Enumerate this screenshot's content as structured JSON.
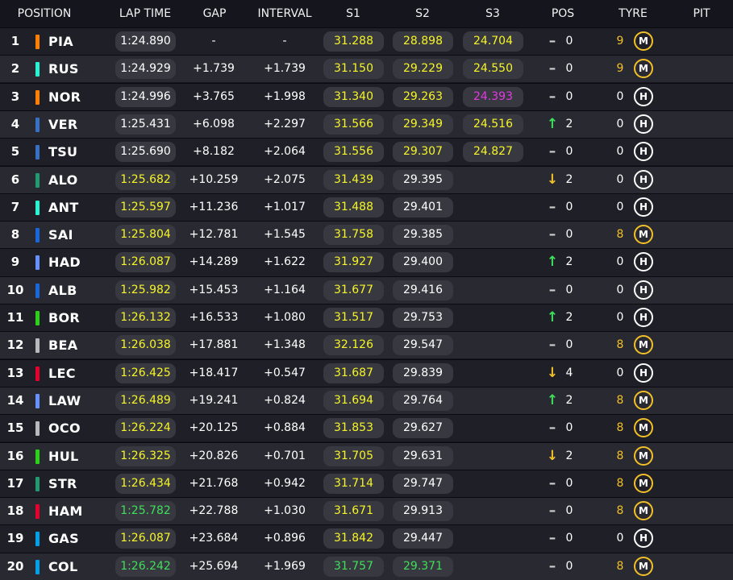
{
  "headers": {
    "position": "POSITION",
    "lap_time": "LAP TIME",
    "gap": "GAP",
    "interval": "INTERVAL",
    "s1": "S1",
    "s2": "S2",
    "s3": "S3",
    "pos": "POS",
    "tyre": "TYRE",
    "pit": "PIT"
  },
  "colors": {
    "yellow": "#f5f527",
    "green": "#3ee05a",
    "purple": "#e23ae2",
    "mclaren": "#ff8000",
    "mercedes": "#27f4d2",
    "redbull": "#3671c6",
    "astonmartin": "#229971",
    "williams": "#1868db",
    "racingbulls": "#6692ff",
    "sauber": "#2bd117",
    "haas": "#b6babd",
    "ferrari": "#e8002d",
    "alpine": "#00a1e8"
  },
  "rows": [
    {
      "pos": "1",
      "driver": "PIA",
      "team_color": "#ff8000",
      "lap": "1:24.890",
      "lap_c": "white",
      "gap": "-",
      "interval": "-",
      "s1": "31.288",
      "s1_c": "yellow",
      "s2": "28.898",
      "s2_c": "yellow",
      "s3": "24.704",
      "s3_c": "yellow",
      "arrow": "dash",
      "change": "0",
      "tyre_age": "9",
      "tyre": "M"
    },
    {
      "pos": "2",
      "driver": "RUS",
      "team_color": "#27f4d2",
      "lap": "1:24.929",
      "lap_c": "white",
      "gap": "+1.739",
      "interval": "+1.739",
      "s1": "31.150",
      "s1_c": "yellow",
      "s2": "29.229",
      "s2_c": "yellow",
      "s3": "24.550",
      "s3_c": "yellow",
      "arrow": "dash",
      "change": "0",
      "tyre_age": "9",
      "tyre": "M"
    },
    {
      "pos": "3",
      "driver": "NOR",
      "team_color": "#ff8000",
      "lap": "1:24.996",
      "lap_c": "white",
      "gap": "+3.765",
      "interval": "+1.998",
      "s1": "31.340",
      "s1_c": "yellow",
      "s2": "29.263",
      "s2_c": "yellow",
      "s3": "24.393",
      "s3_c": "purple",
      "arrow": "dash",
      "change": "0",
      "tyre_age": "0",
      "tyre": "H"
    },
    {
      "pos": "4",
      "driver": "VER",
      "team_color": "#3671c6",
      "lap": "1:25.431",
      "lap_c": "white",
      "gap": "+6.098",
      "interval": "+2.297",
      "s1": "31.566",
      "s1_c": "yellow",
      "s2": "29.349",
      "s2_c": "yellow",
      "s3": "24.516",
      "s3_c": "yellow",
      "arrow": "up",
      "change": "2",
      "tyre_age": "0",
      "tyre": "H"
    },
    {
      "pos": "5",
      "driver": "TSU",
      "team_color": "#3671c6",
      "lap": "1:25.690",
      "lap_c": "white",
      "gap": "+8.182",
      "interval": "+2.064",
      "s1": "31.556",
      "s1_c": "yellow",
      "s2": "29.307",
      "s2_c": "yellow",
      "s3": "24.827",
      "s3_c": "yellow",
      "arrow": "dash",
      "change": "0",
      "tyre_age": "0",
      "tyre": "H"
    },
    {
      "pos": "6",
      "driver": "ALO",
      "team_color": "#229971",
      "lap": "1:25.682",
      "lap_c": "yellow",
      "gap": "+10.259",
      "interval": "+2.075",
      "s1": "31.439",
      "s1_c": "yellow",
      "s2": "29.395",
      "s2_c": "white",
      "s3": "",
      "s3_c": "white",
      "arrow": "down",
      "change": "2",
      "tyre_age": "0",
      "tyre": "H"
    },
    {
      "pos": "7",
      "driver": "ANT",
      "team_color": "#27f4d2",
      "lap": "1:25.597",
      "lap_c": "yellow",
      "gap": "+11.236",
      "interval": "+1.017",
      "s1": "31.488",
      "s1_c": "yellow",
      "s2": "29.401",
      "s2_c": "white",
      "s3": "",
      "s3_c": "white",
      "arrow": "dash",
      "change": "0",
      "tyre_age": "0",
      "tyre": "H"
    },
    {
      "pos": "8",
      "driver": "SAI",
      "team_color": "#1868db",
      "lap": "1:25.804",
      "lap_c": "yellow",
      "gap": "+12.781",
      "interval": "+1.545",
      "s1": "31.758",
      "s1_c": "yellow",
      "s2": "29.385",
      "s2_c": "white",
      "s3": "",
      "s3_c": "white",
      "arrow": "dash",
      "change": "0",
      "tyre_age": "8",
      "tyre": "M"
    },
    {
      "pos": "9",
      "driver": "HAD",
      "team_color": "#6692ff",
      "lap": "1:26.087",
      "lap_c": "yellow",
      "gap": "+14.289",
      "interval": "+1.622",
      "s1": "31.927",
      "s1_c": "yellow",
      "s2": "29.400",
      "s2_c": "white",
      "s3": "",
      "s3_c": "white",
      "arrow": "up",
      "change": "2",
      "tyre_age": "0",
      "tyre": "H"
    },
    {
      "pos": "10",
      "driver": "ALB",
      "team_color": "#1868db",
      "lap": "1:25.982",
      "lap_c": "yellow",
      "gap": "+15.453",
      "interval": "+1.164",
      "s1": "31.677",
      "s1_c": "yellow",
      "s2": "29.416",
      "s2_c": "white",
      "s3": "",
      "s3_c": "white",
      "arrow": "dash",
      "change": "0",
      "tyre_age": "0",
      "tyre": "H"
    },
    {
      "pos": "11",
      "driver": "BOR",
      "team_color": "#2bd117",
      "lap": "1:26.132",
      "lap_c": "yellow",
      "gap": "+16.533",
      "interval": "+1.080",
      "s1": "31.517",
      "s1_c": "yellow",
      "s2": "29.753",
      "s2_c": "white",
      "s3": "",
      "s3_c": "white",
      "arrow": "up",
      "change": "2",
      "tyre_age": "0",
      "tyre": "H"
    },
    {
      "pos": "12",
      "driver": "BEA",
      "team_color": "#b6babd",
      "lap": "1:26.038",
      "lap_c": "yellow",
      "gap": "+17.881",
      "interval": "+1.348",
      "s1": "32.126",
      "s1_c": "yellow",
      "s2": "29.547",
      "s2_c": "white",
      "s3": "",
      "s3_c": "white",
      "arrow": "dash",
      "change": "0",
      "tyre_age": "8",
      "tyre": "M"
    },
    {
      "pos": "13",
      "driver": "LEC",
      "team_color": "#e8002d",
      "lap": "1:26.425",
      "lap_c": "yellow",
      "gap": "+18.417",
      "interval": "+0.547",
      "s1": "31.687",
      "s1_c": "yellow",
      "s2": "29.839",
      "s2_c": "white",
      "s3": "",
      "s3_c": "white",
      "arrow": "down",
      "change": "4",
      "tyre_age": "0",
      "tyre": "H"
    },
    {
      "pos": "14",
      "driver": "LAW",
      "team_color": "#6692ff",
      "lap": "1:26.489",
      "lap_c": "yellow",
      "gap": "+19.241",
      "interval": "+0.824",
      "s1": "31.694",
      "s1_c": "yellow",
      "s2": "29.764",
      "s2_c": "white",
      "s3": "",
      "s3_c": "white",
      "arrow": "up",
      "change": "2",
      "tyre_age": "8",
      "tyre": "M"
    },
    {
      "pos": "15",
      "driver": "OCO",
      "team_color": "#b6babd",
      "lap": "1:26.224",
      "lap_c": "yellow",
      "gap": "+20.125",
      "interval": "+0.884",
      "s1": "31.853",
      "s1_c": "yellow",
      "s2": "29.627",
      "s2_c": "white",
      "s3": "",
      "s3_c": "white",
      "arrow": "dash",
      "change": "0",
      "tyre_age": "8",
      "tyre": "M"
    },
    {
      "pos": "16",
      "driver": "HUL",
      "team_color": "#2bd117",
      "lap": "1:26.325",
      "lap_c": "yellow",
      "gap": "+20.826",
      "interval": "+0.701",
      "s1": "31.705",
      "s1_c": "yellow",
      "s2": "29.631",
      "s2_c": "white",
      "s3": "",
      "s3_c": "white",
      "arrow": "down",
      "change": "2",
      "tyre_age": "8",
      "tyre": "M"
    },
    {
      "pos": "17",
      "driver": "STR",
      "team_color": "#229971",
      "lap": "1:26.434",
      "lap_c": "yellow",
      "gap": "+21.768",
      "interval": "+0.942",
      "s1": "31.714",
      "s1_c": "yellow",
      "s2": "29.747",
      "s2_c": "white",
      "s3": "",
      "s3_c": "white",
      "arrow": "dash",
      "change": "0",
      "tyre_age": "8",
      "tyre": "M"
    },
    {
      "pos": "18",
      "driver": "HAM",
      "team_color": "#e8002d",
      "lap": "1:25.782",
      "lap_c": "green",
      "gap": "+22.788",
      "interval": "+1.030",
      "s1": "31.671",
      "s1_c": "yellow",
      "s2": "29.913",
      "s2_c": "white",
      "s3": "",
      "s3_c": "white",
      "arrow": "dash",
      "change": "0",
      "tyre_age": "8",
      "tyre": "M"
    },
    {
      "pos": "19",
      "driver": "GAS",
      "team_color": "#00a1e8",
      "lap": "1:26.087",
      "lap_c": "yellow",
      "gap": "+23.684",
      "interval": "+0.896",
      "s1": "31.842",
      "s1_c": "yellow",
      "s2": "29.447",
      "s2_c": "white",
      "s3": "",
      "s3_c": "white",
      "arrow": "dash",
      "change": "0",
      "tyre_age": "0",
      "tyre": "H"
    },
    {
      "pos": "20",
      "driver": "COL",
      "team_color": "#00a1e8",
      "lap": "1:26.242",
      "lap_c": "green",
      "gap": "+25.694",
      "interval": "+1.969",
      "s1": "31.757",
      "s1_c": "green",
      "s2": "29.371",
      "s2_c": "green",
      "s3": "",
      "s3_c": "white",
      "arrow": "dash",
      "change": "0",
      "tyre_age": "8",
      "tyre": "M"
    }
  ]
}
